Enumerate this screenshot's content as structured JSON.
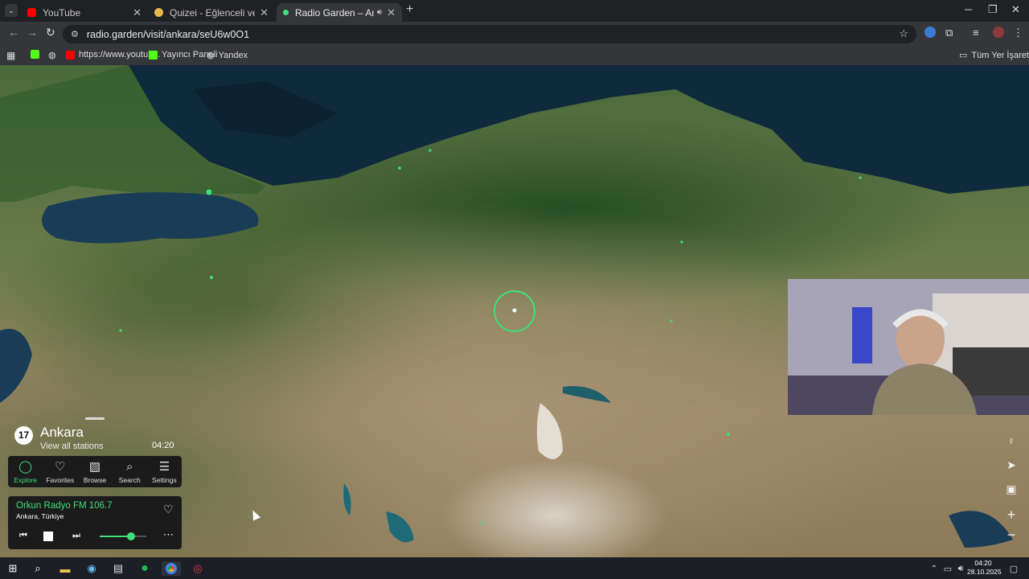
{
  "browser": {
    "tabs": [
      {
        "title": "YouTube",
        "active": false
      },
      {
        "title": "Quizei - Eğlenceli ve etkileşimli",
        "active": false
      },
      {
        "title": "Radio Garden – Ankara",
        "active": true
      }
    ],
    "url": "radio.garden/visit/ankara/seU6w0O1",
    "bookmarks": [
      "https://www.youtub...",
      "Yayıncı Paneli",
      "Yandex"
    ],
    "all_bookmarks": "Tüm Yer İşaretleri"
  },
  "radio": {
    "station_count": "17",
    "city": "Ankara",
    "view_all": "View all stations",
    "local_time": "04:20",
    "nav": [
      "Explore",
      "Favorites",
      "Browse",
      "Search",
      "Settings"
    ],
    "now_playing": {
      "station": "Orkun Radyo FM 106.7",
      "location": "Ankara, Türkiye"
    },
    "volume": 0.68
  },
  "taskbar": {
    "time": "04:20",
    "date": "28.10.2025"
  },
  "colors": {
    "accent": "#3fe07a",
    "browser_bg": "#202124",
    "toolbar_bg": "#35363a"
  }
}
